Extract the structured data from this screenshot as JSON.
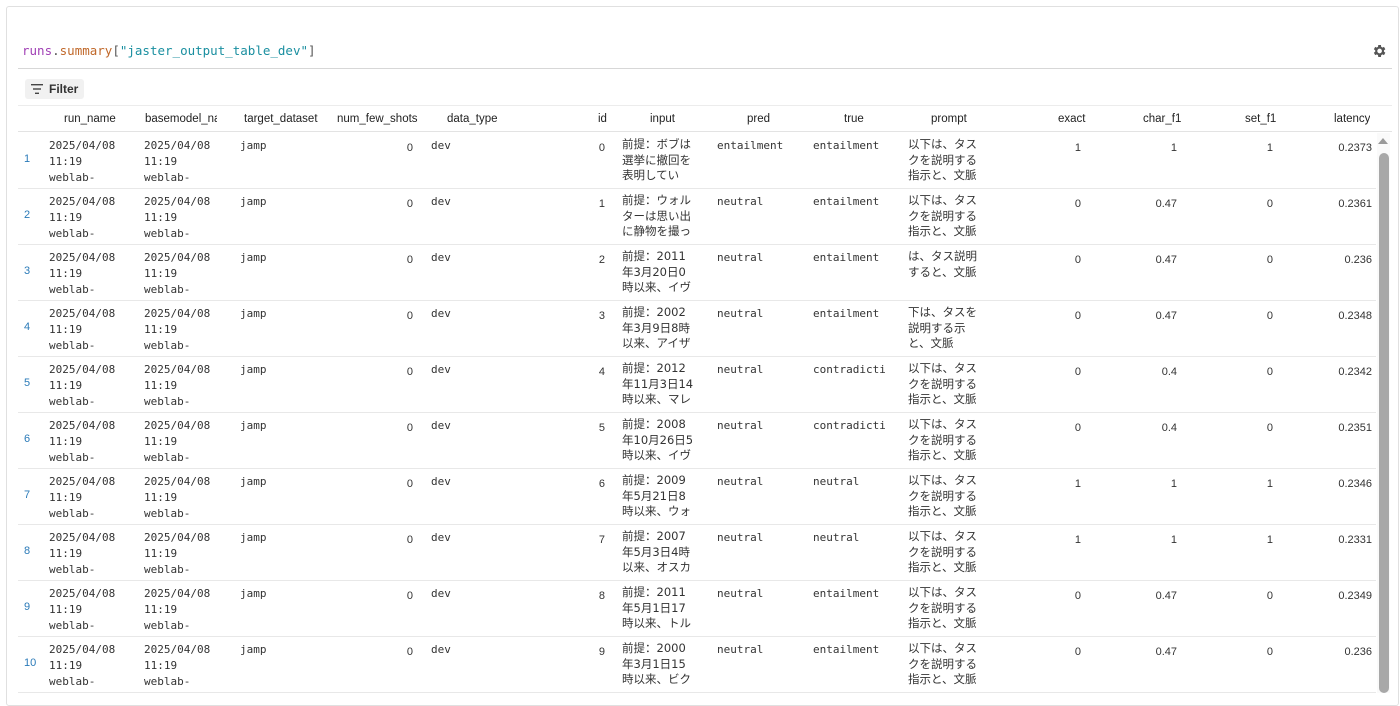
{
  "query": {
    "var": "runs",
    "dot": ".",
    "prop": "summary",
    "open": "[",
    "key": "\"jaster_output_table_dev\"",
    "close": "]"
  },
  "toolbar": {
    "filter_label": "Filter",
    "settings_icon": "gear-icon"
  },
  "columns": [
    "run_name",
    "basemodel_nam",
    "target_dataset",
    "num_few_shots",
    "data_type",
    "id",
    "input",
    "pred",
    "true",
    "prompt",
    "exact",
    "char_f1",
    "set_f1",
    "latency"
  ],
  "rows": [
    {
      "n": "1",
      "run": [
        "2025/04/08",
        "11:19",
        "weblab-"
      ],
      "base": [
        "2025/04/08",
        "11:19",
        "weblab-"
      ],
      "target": "jamp",
      "shots": "0",
      "dtype": "dev",
      "id": "0",
      "input": "前提：ボブは選挙に撤回を表明してい",
      "pred": "entailment",
      "true": "entailment",
      "prompt": "以下は、タスクを説明する指示と、文脈",
      "exact": "1",
      "char": "1",
      "set": "1",
      "lat": "0.2373"
    },
    {
      "n": "2",
      "run": [
        "2025/04/08",
        "11:19",
        "weblab-"
      ],
      "base": [
        "2025/04/08",
        "11:19",
        "weblab-"
      ],
      "target": "jamp",
      "shots": "0",
      "dtype": "dev",
      "id": "1",
      "input": "前提：ウォルターは思い出に静物を撮っ",
      "pred": "neutral",
      "true": "entailment",
      "prompt": "以下は、タスクを説明する指示と、文脈",
      "exact": "0",
      "char": "0.47",
      "set": "0",
      "lat": "0.2361"
    },
    {
      "n": "3",
      "run": [
        "2025/04/08",
        "11:19",
        "weblab-"
      ],
      "base": [
        "2025/04/08",
        "11:19",
        "weblab-"
      ],
      "target": "jamp",
      "shots": "0",
      "dtype": "dev",
      "id": "2",
      "input": "前提：2011年3月20日0時以来、イヴ",
      "pred": "neutral",
      "true": "entailment",
      "prompt": "は、タス説明すると、文脈",
      "exact": "0",
      "char": "0.47",
      "set": "0",
      "lat": "0.236"
    },
    {
      "n": "4",
      "run": [
        "2025/04/08",
        "11:19",
        "weblab-"
      ],
      "base": [
        "2025/04/08",
        "11:19",
        "weblab-"
      ],
      "target": "jamp",
      "shots": "0",
      "dtype": "dev",
      "id": "3",
      "input": "前提：2002年3月9日8時以来、アイザ",
      "pred": "neutral",
      "true": "entailment",
      "prompt": "下は、タスを説明する示と、文脈",
      "exact": "0",
      "char": "0.47",
      "set": "0",
      "lat": "0.2348"
    },
    {
      "n": "5",
      "run": [
        "2025/04/08",
        "11:19",
        "weblab-"
      ],
      "base": [
        "2025/04/08",
        "11:19",
        "weblab-"
      ],
      "target": "jamp",
      "shots": "0",
      "dtype": "dev",
      "id": "4",
      "input": "前提：2012年11月3日14時以来、マレ",
      "pred": "neutral",
      "true": "contradictio",
      "prompt": "以下は、タスクを説明する指示と、文脈",
      "exact": "0",
      "char": "0.4",
      "set": "0",
      "lat": "0.2342"
    },
    {
      "n": "6",
      "run": [
        "2025/04/08",
        "11:19",
        "weblab-"
      ],
      "base": [
        "2025/04/08",
        "11:19",
        "weblab-"
      ],
      "target": "jamp",
      "shots": "0",
      "dtype": "dev",
      "id": "5",
      "input": "前提：2008年10月26日5時以来、イヴ",
      "pred": "neutral",
      "true": "contradictio",
      "prompt": "以下は、タスクを説明する指示と、文脈",
      "exact": "0",
      "char": "0.4",
      "set": "0",
      "lat": "0.2351"
    },
    {
      "n": "7",
      "run": [
        "2025/04/08",
        "11:19",
        "weblab-"
      ],
      "base": [
        "2025/04/08",
        "11:19",
        "weblab-"
      ],
      "target": "jamp",
      "shots": "0",
      "dtype": "dev",
      "id": "6",
      "input": "前提：2009年5月21日8時以来、ウォ",
      "pred": "neutral",
      "true": "neutral",
      "prompt": "以下は、タスクを説明する指示と、文脈",
      "exact": "1",
      "char": "1",
      "set": "1",
      "lat": "0.2346"
    },
    {
      "n": "8",
      "run": [
        "2025/04/08",
        "11:19",
        "weblab-"
      ],
      "base": [
        "2025/04/08",
        "11:19",
        "weblab-"
      ],
      "target": "jamp",
      "shots": "0",
      "dtype": "dev",
      "id": "7",
      "input": "前提：2007年5月3日4時以来、オスカ",
      "pred": "neutral",
      "true": "neutral",
      "prompt": "以下は、タスクを説明する指示と、文脈",
      "exact": "1",
      "char": "1",
      "set": "1",
      "lat": "0.2331"
    },
    {
      "n": "9",
      "run": [
        "2025/04/08",
        "11:19",
        "weblab-"
      ],
      "base": [
        "2025/04/08",
        "11:19",
        "weblab-"
      ],
      "target": "jamp",
      "shots": "0",
      "dtype": "dev",
      "id": "8",
      "input": "前提：2011年5月1日17時以来、トル",
      "pred": "neutral",
      "true": "entailment",
      "prompt": "以下は、タスクを説明する指示と、文脈",
      "exact": "0",
      "char": "0.47",
      "set": "0",
      "lat": "0.2349"
    },
    {
      "n": "10",
      "run": [
        "2025/04/08",
        "11:19",
        "weblab-"
      ],
      "base": [
        "2025/04/08",
        "11:19",
        "weblab-"
      ],
      "target": "jamp",
      "shots": "0",
      "dtype": "dev",
      "id": "9",
      "input": "前提：2000年3月1日15時以来、ビク",
      "pred": "neutral",
      "true": "entailment",
      "prompt": "以下は、タスクを説明する指示と、文脈",
      "exact": "0",
      "char": "0.47",
      "set": "0",
      "lat": "0.236"
    }
  ]
}
